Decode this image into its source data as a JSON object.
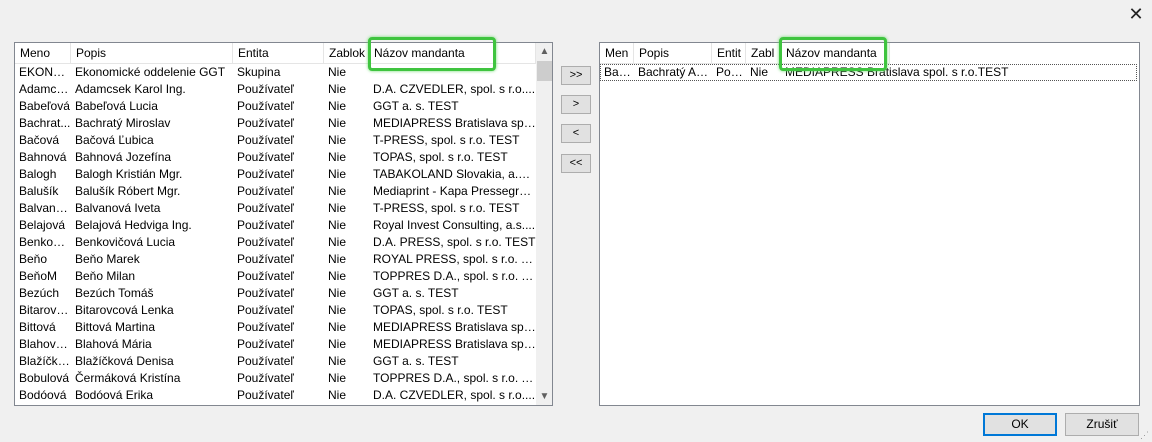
{
  "dialog": {
    "close_glyph": "✕"
  },
  "left_list": {
    "columns": [
      "Meno",
      "Popis",
      "Entita",
      "Zablok",
      "Názov mandanta"
    ],
    "rows": [
      [
        "EKONO...",
        "Ekonomické oddelenie GGT",
        "Skupina",
        "Nie",
        ""
      ],
      [
        "Adamcs...",
        "Adamcsek Karol Ing.",
        "Používateľ",
        "Nie",
        "D.A. CZVEDLER, spol. s r.o...."
      ],
      [
        "Babeľová",
        "Babeľová Lucia",
        "Používateľ",
        "Nie",
        "GGT a. s. TEST"
      ],
      [
        "Bachrat...",
        "Bachratý Miroslav",
        "Používateľ",
        "Nie",
        "MEDIAPRESS Bratislava spol..."
      ],
      [
        "Bačová",
        "Bačová Ľubica",
        "Používateľ",
        "Nie",
        "T-PRESS, spol. s r.o. TEST"
      ],
      [
        "Bahnová",
        "Bahnová Jozefína",
        "Používateľ",
        "Nie",
        "TOPAS, spol. s r.o. TEST"
      ],
      [
        "Balogh",
        "Balogh Kristián Mgr.",
        "Používateľ",
        "Nie",
        "TABAKOLAND Slovakia, a.s...."
      ],
      [
        "Balušík",
        "Balušík Róbert Mgr.",
        "Používateľ",
        "Nie",
        "Mediaprint - Kapa Pressegros..."
      ],
      [
        "Balvano...",
        "Balvanová Iveta",
        "Používateľ",
        "Nie",
        "T-PRESS, spol. s r.o. TEST"
      ],
      [
        "Belajová",
        "Belajová Hedviga Ing.",
        "Používateľ",
        "Nie",
        "Royal Invest Consulting, a.s...."
      ],
      [
        "Benkovi...",
        "Benkovičová Lucia",
        "Používateľ",
        "Nie",
        "D.A. PRESS, spol. s r.o. TEST"
      ],
      [
        "Beňo",
        "Beňo Marek",
        "Používateľ",
        "Nie",
        "ROYAL PRESS, spol. s r.o. T..."
      ],
      [
        "BeňoM",
        "Beňo Milan",
        "Používateľ",
        "Nie",
        "TOPPRES D.A., spol. s r.o. T..."
      ],
      [
        "Bezúch",
        "Bezúch Tomáš",
        "Používateľ",
        "Nie",
        "GGT a. s. TEST"
      ],
      [
        "Bitarovc...",
        "Bitarovcová Lenka",
        "Používateľ",
        "Nie",
        "TOPAS, spol. s r.o. TEST"
      ],
      [
        "Bittová",
        "Bittová Martina",
        "Používateľ",
        "Nie",
        "MEDIAPRESS Bratislava spol..."
      ],
      [
        "Blahová...",
        "Blahová Mária",
        "Používateľ",
        "Nie",
        "MEDIAPRESS Bratislava spol..."
      ],
      [
        "Blažíčko...",
        "Blažíčková Denisa",
        "Používateľ",
        "Nie",
        "GGT a. s. TEST"
      ],
      [
        "Bobulová",
        "Čermáková Kristína",
        "Používateľ",
        "Nie",
        "TOPPRES D.A., spol. s r.o. T..."
      ],
      [
        "Bodóová",
        "Bodóová Erika",
        "Používateľ",
        "Nie",
        "D.A. CZVEDLER, spol. s r.o...."
      ]
    ]
  },
  "right_list": {
    "columns": [
      "Men",
      "Popis",
      "Entit",
      "Zabl",
      "Názov mandanta"
    ],
    "rows": [
      [
        "Bac...",
        "Bachratý Au...",
        "Pou...",
        "Nie",
        "MEDIAPRESS Bratislava spol. s r.o.TEST"
      ]
    ]
  },
  "move_buttons": [
    ">>",
    ">",
    "<",
    "<<"
  ],
  "footer": {
    "ok_label": "OK",
    "cancel_label": "Zrušiť"
  },
  "highlight_color": "#3fc43f"
}
